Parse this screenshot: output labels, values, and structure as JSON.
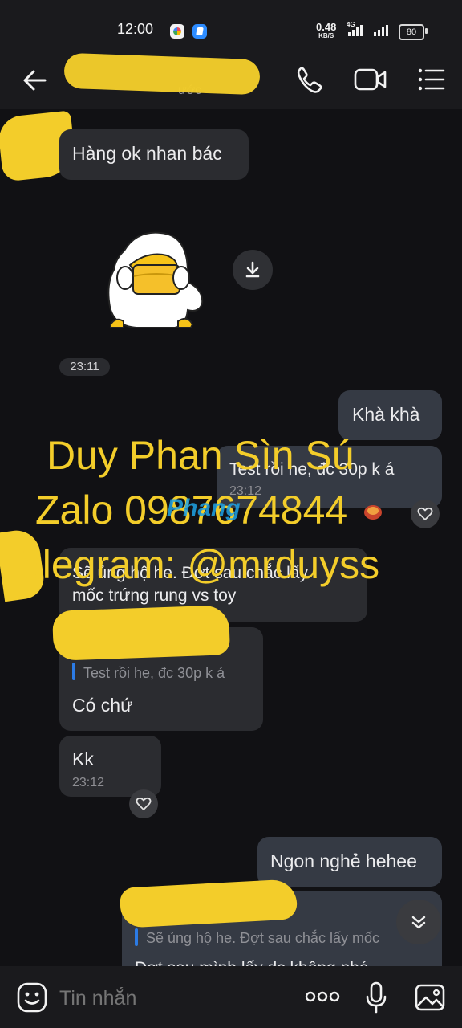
{
  "status_bar": {
    "time": "12:00",
    "net_speed": "0.48",
    "net_unit": "KB/S",
    "network_type": "4G",
    "battery": "80"
  },
  "header": {
    "subtitle_fragment": "ước"
  },
  "messages": {
    "m1": {
      "text": "Hàng ok nhan bác"
    },
    "sticker_time": "23:11",
    "m2": {
      "text": "Khà khà"
    },
    "m3": {
      "text": "Test rồi he, đc 30p k á",
      "time": "23:12"
    },
    "m4": {
      "line1": "Sẽ ủng hộ he. Đợt sau chắc lấy",
      "line2": "mốc trứng rung vs toy"
    },
    "m5": {
      "quote": "Test rồi he, đc 30p k á",
      "text": "Có chứ"
    },
    "m6": {
      "text": "Kk",
      "time": "23:12"
    },
    "m7": {
      "text": "Ngon nghẻ hehee"
    },
    "m8": {
      "quote": "Sẽ ủng hộ he. Đợt sau chắc lấy mốc",
      "partial": "Đợt sau mình lấy dc không nhé"
    }
  },
  "watermark": {
    "line1": "Duy Phan Sìn Sú",
    "line2": "Zalo 0987674844",
    "line3": "Telegram: @mrduyss",
    "logo": "Phang"
  },
  "input": {
    "placeholder": "Tin nhắn"
  },
  "icons": {
    "back": "back-arrow-icon",
    "call": "phone-icon",
    "video": "video-call-icon",
    "menu": "list-menu-icon",
    "download": "download-icon",
    "heart": "heart-icon",
    "scroll_down": "chevron-down-icon",
    "emoji": "emoji-icon",
    "more": "more-icon",
    "mic": "microphone-icon",
    "image": "image-icon"
  },
  "colors": {
    "background": "#111114",
    "bubble_received": "#2b2c30",
    "bubble_sent": "#353a44",
    "quote_accent": "#2c7be5",
    "watermark": "#f3cd2a"
  }
}
